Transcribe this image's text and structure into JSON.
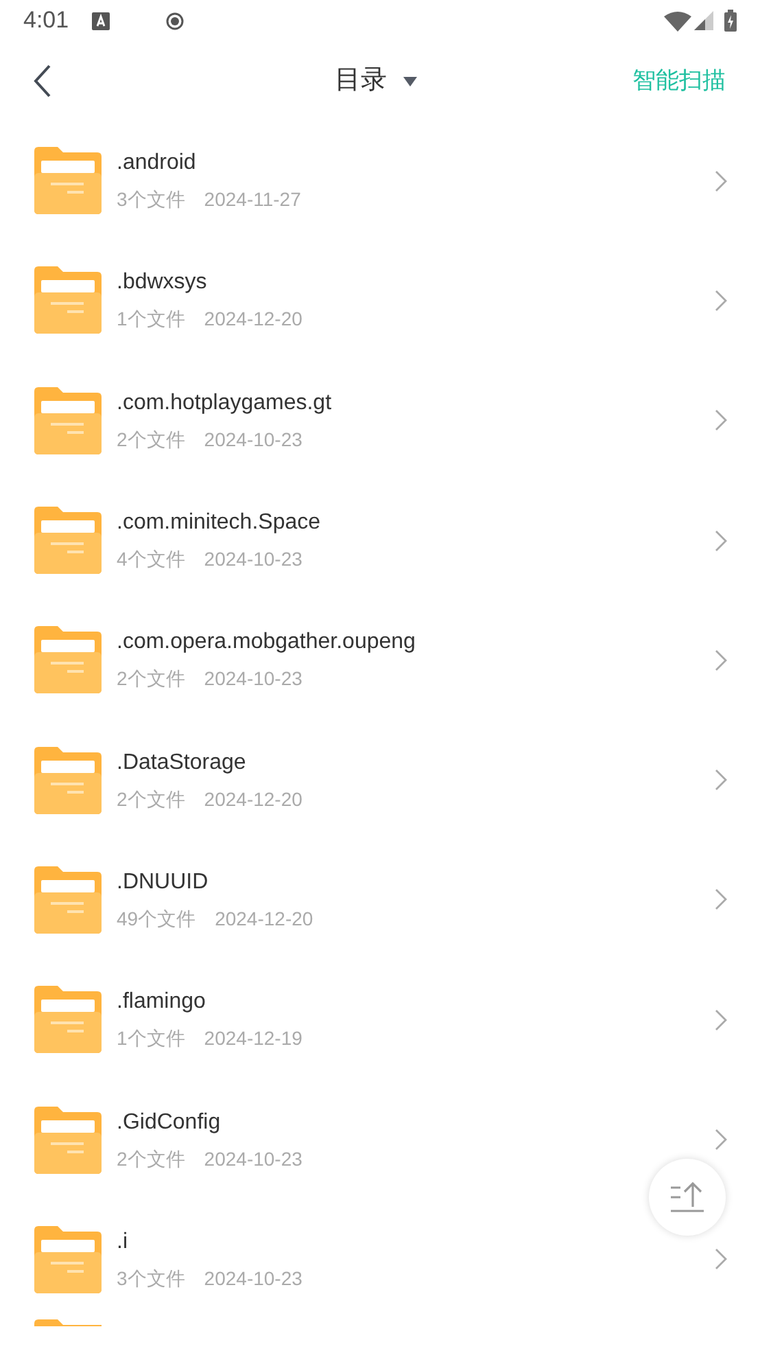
{
  "status_bar": {
    "time": "4:01"
  },
  "header": {
    "title": "目录",
    "action": "智能扫描"
  },
  "folders": [
    {
      "name": ".android",
      "count": "3个文件",
      "date": "2024-11-27"
    },
    {
      "name": ".bdwxsys",
      "count": "1个文件",
      "date": "2024-12-20"
    },
    {
      "name": ".com.hotplaygames.gt",
      "count": "2个文件",
      "date": "2024-10-23"
    },
    {
      "name": ".com.minitech.Space",
      "count": "4个文件",
      "date": "2024-10-23"
    },
    {
      "name": ".com.opera.mobgather.oupeng",
      "count": "2个文件",
      "date": "2024-10-23"
    },
    {
      "name": ".DataStorage",
      "count": "2个文件",
      "date": "2024-12-20"
    },
    {
      "name": ".DNUUID",
      "count": "49个文件",
      "date": "2024-12-20"
    },
    {
      "name": ".flamingo",
      "count": "1个文件",
      "date": "2024-12-19"
    },
    {
      "name": ".GidConfig",
      "count": "2个文件",
      "date": "2024-10-23"
    },
    {
      "name": ".i",
      "count": "3个文件",
      "date": "2024-10-23"
    }
  ]
}
